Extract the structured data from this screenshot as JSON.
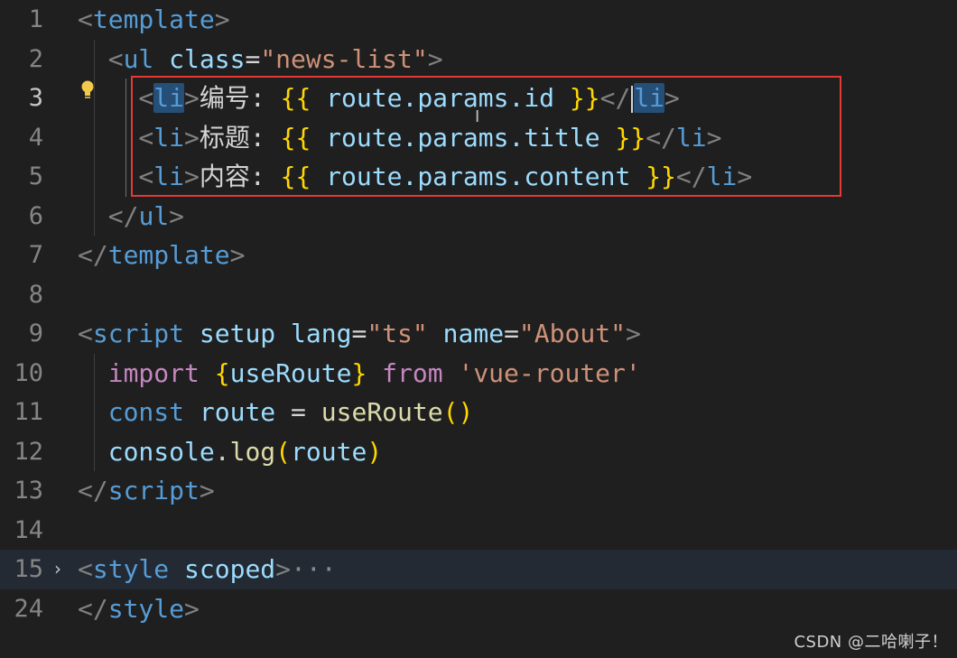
{
  "editor": {
    "lines": [
      {
        "num": "1",
        "segments": [
          [
            "<",
            "punc"
          ],
          [
            "template",
            "tag"
          ],
          [
            ">",
            "punc"
          ]
        ]
      },
      {
        "num": "2",
        "segments": [
          [
            "  <",
            "punc"
          ],
          [
            "ul",
            "tag"
          ],
          [
            " ",
            "cn"
          ],
          [
            "class",
            "attr"
          ],
          [
            "=",
            "cn"
          ],
          [
            "\"news-list\"",
            "str"
          ],
          [
            ">",
            "punc"
          ]
        ]
      },
      {
        "num": "3",
        "segments": [
          [
            "    <",
            "punc"
          ],
          [
            "li",
            "tag-hl"
          ],
          [
            ">",
            "punc"
          ],
          [
            "编号: ",
            "cn"
          ],
          [
            "{{",
            "brace"
          ],
          [
            " route.params.id ",
            "var"
          ],
          [
            "}}",
            "brace"
          ],
          [
            "</",
            "punc"
          ],
          [
            "CARET",
            "caret"
          ],
          [
            "li",
            "tag-hl"
          ],
          [
            ">",
            "punc"
          ]
        ]
      },
      {
        "num": "4",
        "segments": [
          [
            "    <",
            "punc"
          ],
          [
            "li",
            "tag"
          ],
          [
            ">",
            "punc"
          ],
          [
            "标题: ",
            "cn"
          ],
          [
            "{{",
            "brace"
          ],
          [
            " route.params.title ",
            "var"
          ],
          [
            "}}",
            "brace"
          ],
          [
            "</",
            "punc"
          ],
          [
            "li",
            "tag"
          ],
          [
            ">",
            "punc"
          ]
        ]
      },
      {
        "num": "5",
        "segments": [
          [
            "    <",
            "punc"
          ],
          [
            "li",
            "tag"
          ],
          [
            ">",
            "punc"
          ],
          [
            "内容: ",
            "cn"
          ],
          [
            "{{",
            "brace"
          ],
          [
            " route.params.content ",
            "var"
          ],
          [
            "}}",
            "brace"
          ],
          [
            "</",
            "punc"
          ],
          [
            "li",
            "tag"
          ],
          [
            ">",
            "punc"
          ]
        ]
      },
      {
        "num": "6",
        "segments": [
          [
            "  </",
            "punc"
          ],
          [
            "ul",
            "tag"
          ],
          [
            ">",
            "punc"
          ]
        ]
      },
      {
        "num": "7",
        "segments": [
          [
            "</",
            "punc"
          ],
          [
            "template",
            "tag"
          ],
          [
            ">",
            "punc"
          ]
        ]
      },
      {
        "num": "8",
        "segments": []
      },
      {
        "num": "9",
        "segments": [
          [
            "<",
            "punc"
          ],
          [
            "script",
            "tag"
          ],
          [
            " ",
            "cn"
          ],
          [
            "setup",
            "attr"
          ],
          [
            " ",
            "cn"
          ],
          [
            "lang",
            "attr"
          ],
          [
            "=",
            "cn"
          ],
          [
            "\"ts\"",
            "str"
          ],
          [
            " ",
            "cn"
          ],
          [
            "name",
            "attr"
          ],
          [
            "=",
            "cn"
          ],
          [
            "\"About\"",
            "str"
          ],
          [
            ">",
            "punc"
          ]
        ]
      },
      {
        "num": "10",
        "segments": [
          [
            "  ",
            "cn"
          ],
          [
            "import",
            "kw2"
          ],
          [
            " ",
            "cn"
          ],
          [
            "{",
            "brace"
          ],
          [
            "useRoute",
            "var"
          ],
          [
            "}",
            "brace"
          ],
          [
            " ",
            "cn"
          ],
          [
            "from",
            "kw2"
          ],
          [
            " ",
            "cn"
          ],
          [
            "'vue-router'",
            "str"
          ]
        ]
      },
      {
        "num": "11",
        "segments": [
          [
            "  ",
            "cn"
          ],
          [
            "const",
            "kw"
          ],
          [
            " ",
            "cn"
          ],
          [
            "route",
            "var"
          ],
          [
            " = ",
            "cn"
          ],
          [
            "useRoute",
            "fn"
          ],
          [
            "()",
            "paren"
          ]
        ]
      },
      {
        "num": "12",
        "segments": [
          [
            "  ",
            "cn"
          ],
          [
            "console",
            "var"
          ],
          [
            ".",
            "cn"
          ],
          [
            "log",
            "fn"
          ],
          [
            "(",
            "paren"
          ],
          [
            "route",
            "var"
          ],
          [
            ")",
            "paren"
          ]
        ]
      },
      {
        "num": "13",
        "segments": [
          [
            "</",
            "punc"
          ],
          [
            "script",
            "tag"
          ],
          [
            ">",
            "punc"
          ]
        ]
      },
      {
        "num": "14",
        "segments": []
      },
      {
        "num": "15",
        "segments": [
          [
            "<",
            "punc"
          ],
          [
            "style",
            "tag"
          ],
          [
            " ",
            "cn"
          ],
          [
            "scoped",
            "attr"
          ],
          [
            ">",
            "punc"
          ],
          [
            "···",
            "ellipsis"
          ]
        ],
        "folded": true
      },
      {
        "num": "24",
        "segments": [
          [
            "</",
            "punc"
          ],
          [
            "style",
            "tag"
          ],
          [
            ">",
            "punc"
          ]
        ]
      }
    ],
    "active_line": "3",
    "fold_icon": "chevron-right-icon",
    "lightbulb_icon": "lightbulb-icon"
  },
  "watermark": "CSDN @二哈喇子！",
  "colors": {
    "background": "#1f1f1f",
    "tag": "#569cd6",
    "attribute": "#9cdcfe",
    "string": "#ce9178",
    "brace": "#ffd700",
    "keyword_control": "#c586c0",
    "function": "#dcdcaa",
    "highlight_box": "#e53935"
  }
}
